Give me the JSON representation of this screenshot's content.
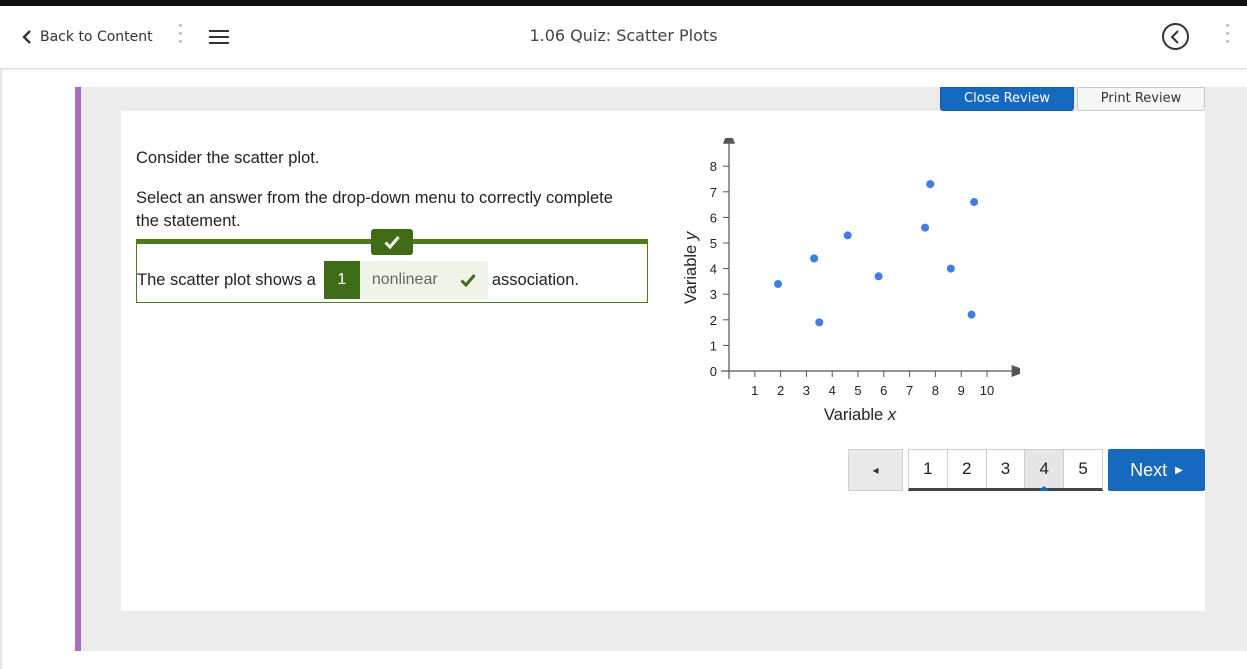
{
  "header": {
    "back_label": "Back to Content",
    "title": "1.06 Quiz: Scatter Plots",
    "icons": [
      "chevron-left-icon",
      "menu-icon",
      "circle-back-icon",
      "more-vertical-icon"
    ]
  },
  "review": {
    "close_label": "Close Review",
    "print_label": "Print Review"
  },
  "question": {
    "prompt": "Consider the scatter plot.",
    "instruction": "Select an answer from the drop-down menu to correctly complete the statement.",
    "statement_before": "The scatter plot shows a",
    "answer_number": "1",
    "selected_answer": "nonlinear",
    "statement_after": "association.",
    "status": "correct"
  },
  "chart_data": {
    "type": "scatter",
    "xlabel_main": "Variable ",
    "xlabel_var": "x",
    "ylabel_main": "Variable ",
    "ylabel_var": "y",
    "xticks": [
      1,
      2,
      3,
      4,
      5,
      6,
      7,
      8,
      9,
      10
    ],
    "yticks": [
      0,
      1,
      2,
      3,
      4,
      5,
      6,
      7,
      8
    ],
    "xlim": [
      0,
      10.8
    ],
    "ylim": [
      0,
      8.8
    ],
    "points": [
      {
        "x": 1.9,
        "y": 3.4
      },
      {
        "x": 3.3,
        "y": 4.4
      },
      {
        "x": 3.5,
        "y": 1.9
      },
      {
        "x": 4.6,
        "y": 5.3
      },
      {
        "x": 5.8,
        "y": 3.7
      },
      {
        "x": 7.6,
        "y": 5.6
      },
      {
        "x": 7.8,
        "y": 7.3
      },
      {
        "x": 8.6,
        "y": 4.0
      },
      {
        "x": 9.4,
        "y": 2.2
      },
      {
        "x": 9.5,
        "y": 6.6
      }
    ],
    "point_color": "#3f7fe0",
    "axis_color": "#555555"
  },
  "pager": {
    "prev_label": "◂",
    "pages": [
      "1",
      "2",
      "3",
      "4",
      "5"
    ],
    "current": "4",
    "next_label": "Next"
  },
  "colors": {
    "accent": "#1769c0",
    "correct": "#3f6d17",
    "stage_border": "#a86cc1"
  }
}
